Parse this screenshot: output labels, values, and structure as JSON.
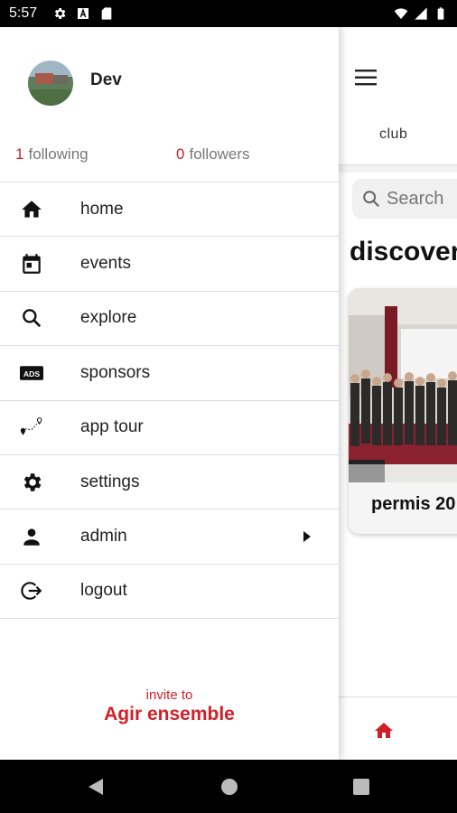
{
  "status_bar": {
    "time": "5:57",
    "left_icons": [
      "settings-icon",
      "a-icon",
      "sd-card-icon"
    ],
    "right_icons": [
      "wifi-icon",
      "signal-icon",
      "battery-icon"
    ]
  },
  "drawer": {
    "user": {
      "name": "Dev",
      "following_count": "1",
      "following_label": "following",
      "followers_count": "0",
      "followers_label": "followers"
    },
    "menu": [
      {
        "label": "home",
        "icon": "home-icon"
      },
      {
        "label": "events",
        "icon": "calendar-icon"
      },
      {
        "label": "explore",
        "icon": "search-icon"
      },
      {
        "label": "sponsors",
        "icon": "ads-icon"
      },
      {
        "label": "app tour",
        "icon": "route-icon"
      },
      {
        "label": "settings",
        "icon": "gear-icon"
      },
      {
        "label": "admin",
        "icon": "person-icon"
      },
      {
        "label": "logout",
        "icon": "logout-icon"
      }
    ],
    "invite": {
      "prefix": "invite to",
      "name": "Agir ensemble"
    }
  },
  "background_app": {
    "tab": "club",
    "search_placeholder": "Search",
    "section_title": "discover",
    "card_caption": "permis 20"
  },
  "colors": {
    "accent": "#d21f26",
    "text": "#222222",
    "divider": "#dddddd"
  }
}
